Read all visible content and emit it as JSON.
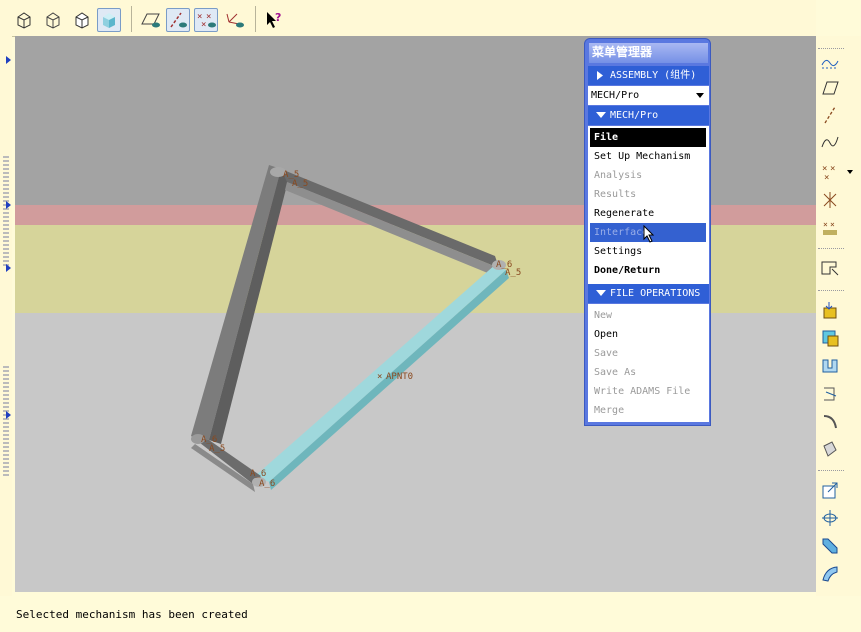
{
  "toolbar": {
    "buttons": [
      {
        "icon": "wireframe-cube-icon"
      },
      {
        "icon": "hidden-line-cube-icon"
      },
      {
        "icon": "no-hidden-cube-icon"
      },
      {
        "icon": "shaded-cube-icon",
        "active": true
      },
      {
        "icon": "datum-plane-display-icon"
      },
      {
        "icon": "datum-axis-display-icon"
      },
      {
        "icon": "datum-point-display-icon"
      },
      {
        "icon": "coordinate-system-display-icon"
      },
      {
        "icon": "context-help-icon"
      }
    ]
  },
  "viewport": {
    "colors": {
      "gray_top": "#a3a3a3",
      "red_band": "#d19c9c",
      "yellow_band": "#d6d49a",
      "gray_bottom": "#c8c8c8"
    },
    "labels": {
      "top_a5a": "A_5",
      "top_a5b": "A_5",
      "right_a6": "A_6",
      "right_a5": "A_5",
      "left_a6": "A_6",
      "left_a5": "A_5",
      "bottom_a6a": "A_6",
      "bottom_a6b": "A_6",
      "point": "APNT0"
    }
  },
  "menu_manager": {
    "title": "菜单管理器",
    "assembly_header": "ASSEMBLY (组件)",
    "dropdown_value": "MECH/Pro",
    "mech_header": "MECH/Pro",
    "mech_items": [
      {
        "label": "File",
        "state": "selected"
      },
      {
        "label": "Set Up Mechanism",
        "state": "enabled"
      },
      {
        "label": "Analysis",
        "state": "disabled"
      },
      {
        "label": "Results",
        "state": "disabled"
      },
      {
        "label": "Regenerate",
        "state": "enabled"
      },
      {
        "label": "Interface",
        "state": "hover"
      },
      {
        "label": "Settings",
        "state": "enabled"
      },
      {
        "label": "Done/Return",
        "state": "bold"
      }
    ],
    "file_header": "FILE OPERATIONS",
    "file_items": [
      {
        "label": "New",
        "state": "disabled"
      },
      {
        "label": "Open",
        "state": "enabled"
      },
      {
        "label": "Save",
        "state": "disabled"
      },
      {
        "label": "Save As",
        "state": "disabled"
      },
      {
        "label": "Write ADAMS File",
        "state": "disabled"
      },
      {
        "label": "Merge",
        "state": "disabled"
      }
    ]
  },
  "status": {
    "message": "Selected mechanism has been created"
  }
}
